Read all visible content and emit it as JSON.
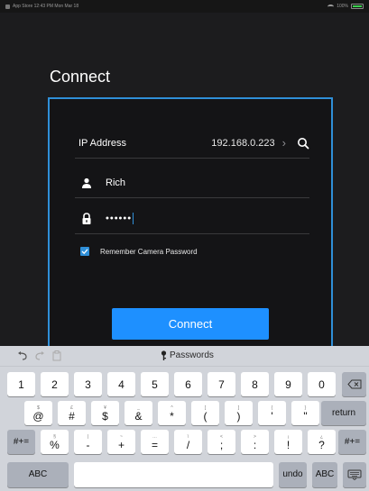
{
  "status": {
    "left": "App Store  12:43 PM  Mon Mar 18",
    "battery": "100%"
  },
  "title": "Connect",
  "form": {
    "ip_label": "IP Address",
    "ip_value": "192.168.0.223",
    "username": "Rich",
    "password_mask": "••••••",
    "remember_label": "Remember Camera Password",
    "connect_label": "Connect"
  },
  "keyboard": {
    "passwords_label": "Passwords",
    "row1": [
      {
        "main": "1",
        "sub": ""
      },
      {
        "main": "2",
        "sub": ""
      },
      {
        "main": "3",
        "sub": ""
      },
      {
        "main": "4",
        "sub": ""
      },
      {
        "main": "5",
        "sub": ""
      },
      {
        "main": "6",
        "sub": ""
      },
      {
        "main": "7",
        "sub": ""
      },
      {
        "main": "8",
        "sub": ""
      },
      {
        "main": "9",
        "sub": ""
      },
      {
        "main": "0",
        "sub": ""
      }
    ],
    "row2": [
      {
        "main": "@",
        "sub": "$"
      },
      {
        "main": "#",
        "sub": "£"
      },
      {
        "main": "$",
        "sub": "¥"
      },
      {
        "main": "&",
        "sub": "_"
      },
      {
        "main": "*",
        "sub": "^"
      },
      {
        "main": "(",
        "sub": "["
      },
      {
        "main": ")",
        "sub": "]"
      },
      {
        "main": "'",
        "sub": "{"
      },
      {
        "main": "\"",
        "sub": "}"
      }
    ],
    "row3": [
      {
        "main": "%",
        "sub": "§"
      },
      {
        "main": "-",
        "sub": "|"
      },
      {
        "main": "+",
        "sub": "~"
      },
      {
        "main": "=",
        "sub": "…"
      },
      {
        "main": "/",
        "sub": "\\"
      },
      {
        "main": ";",
        "sub": "<"
      },
      {
        "main": ":",
        "sub": ">"
      },
      {
        "main": "!",
        "sub": "¡"
      },
      {
        "main": "?",
        "sub": "¿"
      }
    ],
    "return_label": "return",
    "symbols_label": "#+=",
    "abc_label": "ABC",
    "undo_label": "undo"
  }
}
